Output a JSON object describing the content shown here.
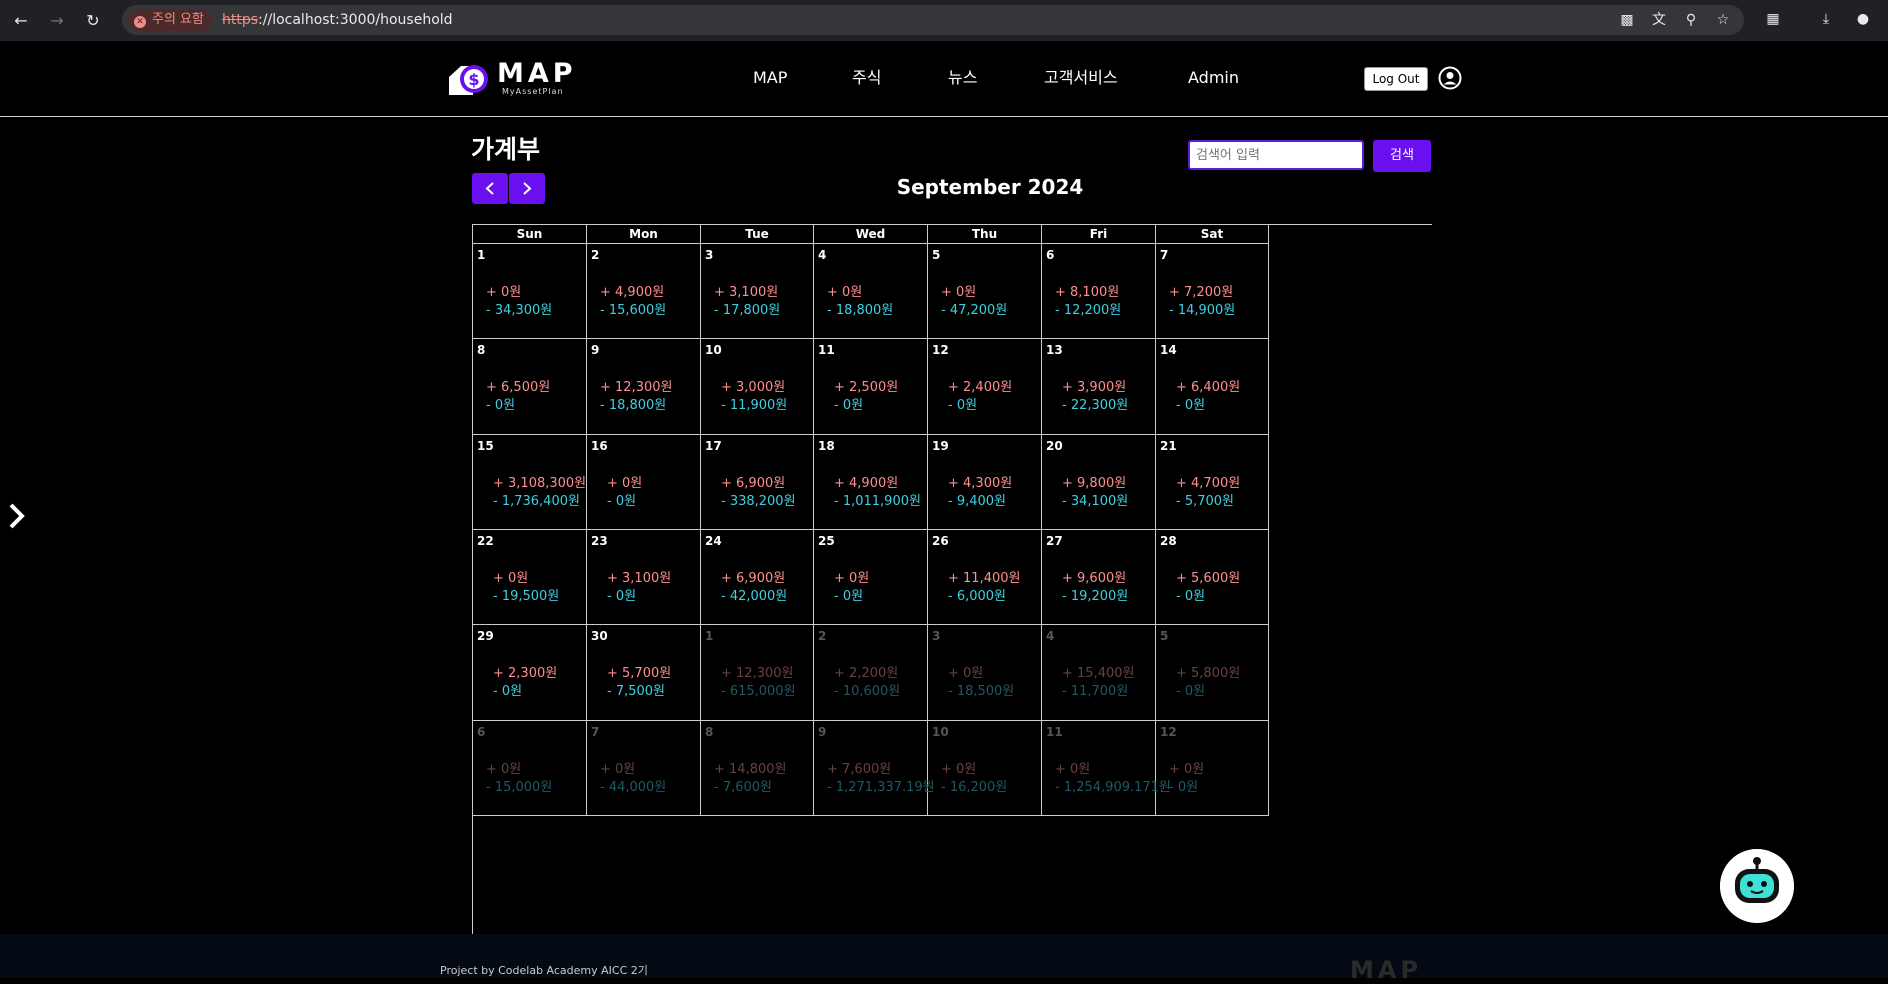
{
  "browser": {
    "warning": "주의 요함",
    "url_scheme": "https",
    "url_rest": "://localhost:3000/household"
  },
  "header": {
    "logo_word": "MAP",
    "logo_sub": "MyAssetPlan",
    "menu": [
      "MAP",
      "주식",
      "뉴스",
      "고객서비스",
      "Admin"
    ],
    "logout": "Log Out"
  },
  "page": {
    "title": "가계부",
    "search_placeholder": "검색어 입력",
    "search_button": "검색",
    "month": "September 2024"
  },
  "calendar": {
    "weekdays": [
      "Sun",
      "Mon",
      "Tue",
      "Wed",
      "Thu",
      "Fri",
      "Sat"
    ],
    "days": [
      {
        "d": "1",
        "inc": "+ 0원",
        "exp": "- 34,300원",
        "cur": true
      },
      {
        "d": "2",
        "inc": "+ 4,900원",
        "exp": "- 15,600원",
        "cur": true
      },
      {
        "d": "3",
        "inc": "+ 3,100원",
        "exp": "- 17,800원",
        "cur": true
      },
      {
        "d": "4",
        "inc": "+ 0원",
        "exp": "- 18,800원",
        "cur": true
      },
      {
        "d": "5",
        "inc": "+ 0원",
        "exp": "- 47,200원",
        "cur": true
      },
      {
        "d": "6",
        "inc": "+ 8,100원",
        "exp": "- 12,200원",
        "cur": true
      },
      {
        "d": "7",
        "inc": "+ 7,200원",
        "exp": "- 14,900원",
        "cur": true
      },
      {
        "d": "8",
        "inc": "+ 6,500원",
        "exp": "- 0원",
        "cur": true
      },
      {
        "d": "9",
        "inc": "+ 12,300원",
        "exp": "- 18,800원",
        "cur": true
      },
      {
        "d": "10",
        "inc": "+ 3,000원",
        "exp": "- 11,900원",
        "cur": true
      },
      {
        "d": "11",
        "inc": "+ 2,500원",
        "exp": "- 0원",
        "cur": true
      },
      {
        "d": "12",
        "inc": "+ 2,400원",
        "exp": "- 0원",
        "cur": true
      },
      {
        "d": "13",
        "inc": "+ 3,900원",
        "exp": "- 22,300원",
        "cur": true
      },
      {
        "d": "14",
        "inc": "+ 6,400원",
        "exp": "- 0원",
        "cur": true
      },
      {
        "d": "15",
        "inc": "+ 3,108,300원",
        "exp": "- 1,736,400원",
        "cur": true
      },
      {
        "d": "16",
        "inc": "+ 0원",
        "exp": "- 0원",
        "cur": true
      },
      {
        "d": "17",
        "inc": "+ 6,900원",
        "exp": "- 338,200원",
        "cur": true
      },
      {
        "d": "18",
        "inc": "+ 4,900원",
        "exp": "- 1,011,900원",
        "cur": true
      },
      {
        "d": "19",
        "inc": "+ 4,300원",
        "exp": "- 9,400원",
        "cur": true
      },
      {
        "d": "20",
        "inc": "+ 9,800원",
        "exp": "- 34,100원",
        "cur": true
      },
      {
        "d": "21",
        "inc": "+ 4,700원",
        "exp": "- 5,700원",
        "cur": true
      },
      {
        "d": "22",
        "inc": "+ 0원",
        "exp": "- 19,500원",
        "cur": true
      },
      {
        "d": "23",
        "inc": "+ 3,100원",
        "exp": "- 0원",
        "cur": true
      },
      {
        "d": "24",
        "inc": "+ 6,900원",
        "exp": "- 42,000원",
        "cur": true
      },
      {
        "d": "25",
        "inc": "+ 0원",
        "exp": "- 0원",
        "cur": true
      },
      {
        "d": "26",
        "inc": "+ 11,400원",
        "exp": "- 6,000원",
        "cur": true
      },
      {
        "d": "27",
        "inc": "+ 9,600원",
        "exp": "- 19,200원",
        "cur": true
      },
      {
        "d": "28",
        "inc": "+ 5,600원",
        "exp": "- 0원",
        "cur": true
      },
      {
        "d": "29",
        "inc": "+ 2,300원",
        "exp": "- 0원",
        "cur": true
      },
      {
        "d": "30",
        "inc": "+ 5,700원",
        "exp": "- 7,500원",
        "cur": true
      },
      {
        "d": "1",
        "inc": "+ 12,300원",
        "exp": "- 615,000원",
        "cur": false
      },
      {
        "d": "2",
        "inc": "+ 2,200원",
        "exp": "- 10,600원",
        "cur": false
      },
      {
        "d": "3",
        "inc": "+ 0원",
        "exp": "- 18,500원",
        "cur": false
      },
      {
        "d": "4",
        "inc": "+ 15,400원",
        "exp": "- 11,700원",
        "cur": false
      },
      {
        "d": "5",
        "inc": "+ 5,800원",
        "exp": "- 0원",
        "cur": false
      },
      {
        "d": "6",
        "inc": "+ 0원",
        "exp": "- 15,000원",
        "cur": false
      },
      {
        "d": "7",
        "inc": "+ 0원",
        "exp": "- 44,000원",
        "cur": false
      },
      {
        "d": "8",
        "inc": "+ 14,800원",
        "exp": "- 7,600원",
        "cur": false
      },
      {
        "d": "9",
        "inc": "+ 7,600원",
        "exp": "- 1,271,337.19원",
        "cur": false
      },
      {
        "d": "10",
        "inc": "+ 0원",
        "exp": "- 16,200원",
        "cur": false
      },
      {
        "d": "11",
        "inc": "+ 0원",
        "exp": "- 1,254,909.171원",
        "cur": false
      },
      {
        "d": "12",
        "inc": "+ 0원",
        "exp": "- 0원",
        "cur": false
      }
    ]
  },
  "footer": {
    "credit": "Project by Codelab Academy AICC 2기",
    "logo_word": "MAP"
  }
}
